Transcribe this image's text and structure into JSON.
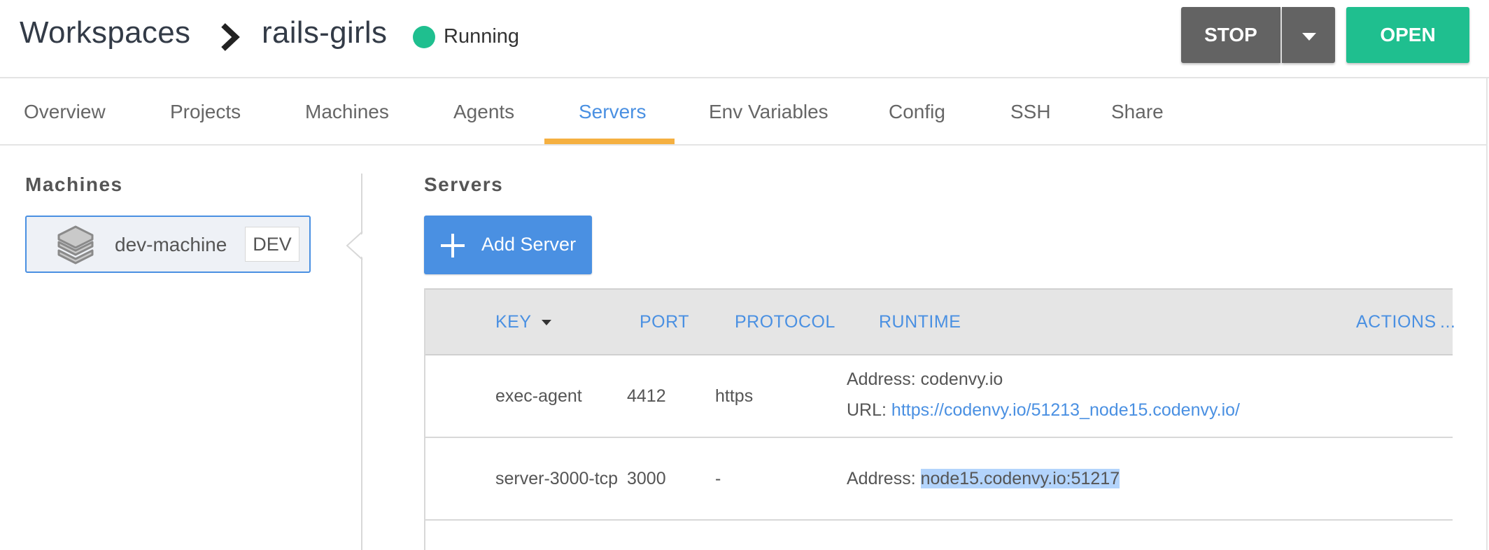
{
  "header": {
    "breadcrumb_root": "Workspaces",
    "workspace_name": "rails-girls",
    "status": "Running",
    "stop_label": "STOP",
    "open_label": "OPEN"
  },
  "tabs": [
    {
      "label": "Overview"
    },
    {
      "label": "Projects"
    },
    {
      "label": "Machines"
    },
    {
      "label": "Agents"
    },
    {
      "label": "Servers",
      "active": true
    },
    {
      "label": "Env Variables"
    },
    {
      "label": "Config"
    },
    {
      "label": "SSH"
    },
    {
      "label": "Share"
    }
  ],
  "machines_panel": {
    "heading": "Machines",
    "machine": {
      "name": "dev-machine",
      "badge": "DEV",
      "icon": "layers-icon"
    }
  },
  "servers_panel": {
    "heading": "Servers",
    "add_label": "Add Server",
    "columns": {
      "key": "KEY",
      "port": "PORT",
      "protocol": "PROTOCOL",
      "runtime": "RUNTIME",
      "actions": "ACTIONS",
      "more": "..."
    },
    "rows": [
      {
        "key": "exec-agent",
        "port": "4412",
        "protocol": "https",
        "address_label": "Address:",
        "address": "codenvy.io",
        "url_label": "URL:",
        "url": "https://codenvy.io/51213_node15.codenvy.io/"
      },
      {
        "key": "server-3000-tcp",
        "port": "3000",
        "protocol": "-",
        "address_label": "Address:",
        "address": "node15.codenvy.io:51217"
      }
    ]
  },
  "colors": {
    "accent": "#4a90e2",
    "running": "#1fbf8f",
    "tab_indicator": "#f5b041",
    "stop_button": "#636363"
  }
}
